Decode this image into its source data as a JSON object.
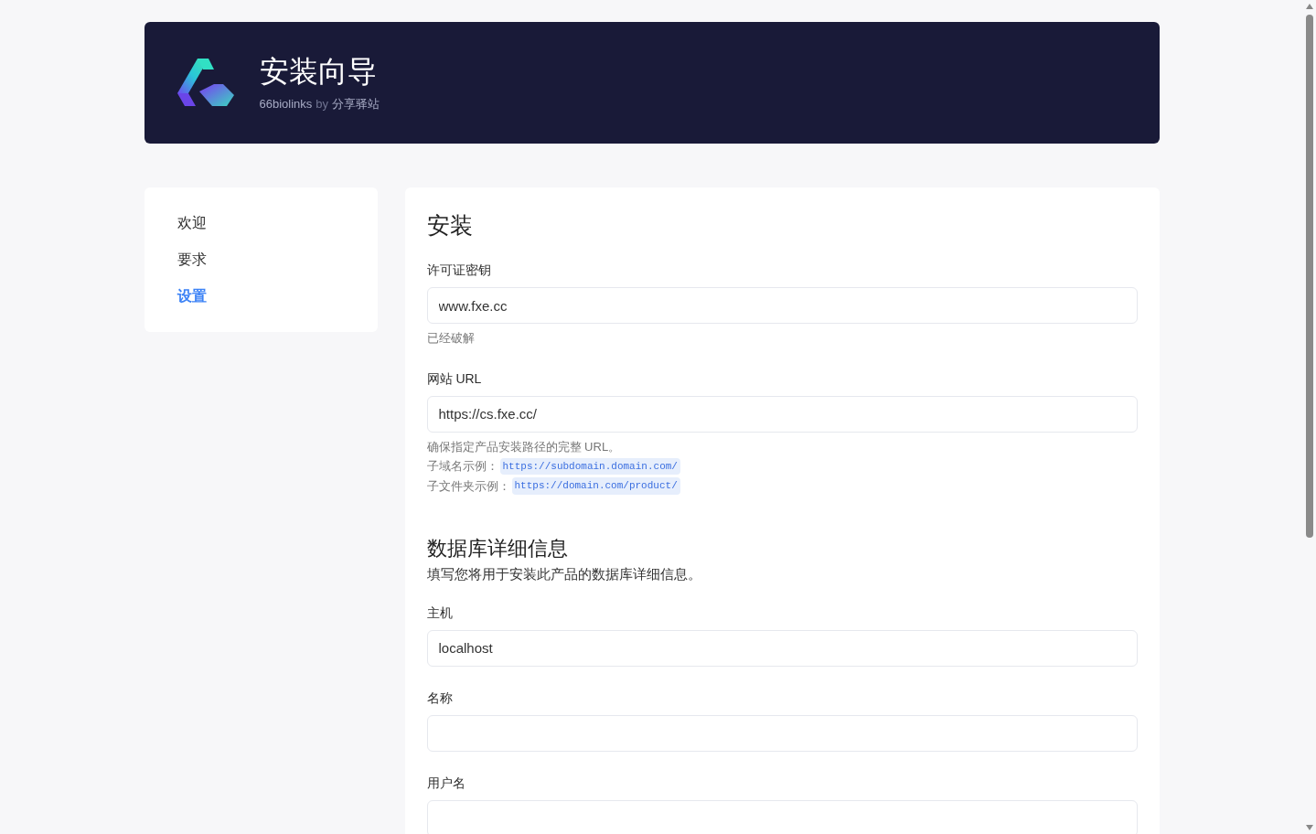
{
  "header": {
    "title": "安装向导",
    "subtitle_product": "66biolinks",
    "subtitle_by": "by",
    "subtitle_author": "分享驿站"
  },
  "sidebar": {
    "items": [
      {
        "label": "欢迎",
        "selected": false
      },
      {
        "label": "要求",
        "selected": false
      },
      {
        "label": "设置",
        "selected": true
      }
    ]
  },
  "main": {
    "title": "安装",
    "license": {
      "label": "许可证密钥",
      "value": "www.fxe.cc",
      "help": "已经破解"
    },
    "url": {
      "label": "网站 URL",
      "value": "https://cs.fxe.cc/",
      "help": "确保指定产品安装路径的完整 URL。",
      "examples": [
        {
          "label": "子域名示例：",
          "code": "https://subdomain.domain.com/"
        },
        {
          "label": "子文件夹示例：",
          "code": "https://domain.com/product/"
        }
      ]
    },
    "database": {
      "title": "数据库详细信息",
      "description": "填写您将用于安装此产品的数据库详细信息。",
      "fields": [
        {
          "label": "主机",
          "value": "localhost"
        },
        {
          "label": "名称"
        },
        {
          "label": "用户名"
        }
      ]
    }
  }
}
